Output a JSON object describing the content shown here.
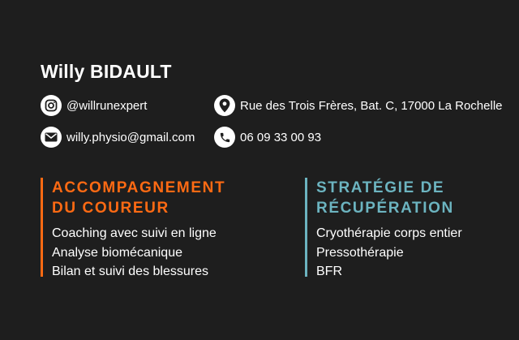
{
  "name": "Willy BIDAULT",
  "contacts": {
    "instagram": {
      "icon": "instagram-icon",
      "text": "@willrunexpert"
    },
    "email": {
      "icon": "mail-icon",
      "text": "willy.physio@gmail.com"
    },
    "address": {
      "icon": "map-pin-icon",
      "text": "Rue des Trois Frères, Bat. C, 17000 La Rochelle"
    },
    "phone": {
      "icon": "phone-icon",
      "text": "06 09 33 00 93"
    }
  },
  "sections": [
    {
      "title_line1": "ACCOMPAGNEMENT",
      "title_line2": "DU COUREUR",
      "color": "#ff6a13",
      "items": [
        "Coaching avec suivi en ligne",
        "Analyse biomécanique",
        "Bilan et suivi des blessures"
      ]
    },
    {
      "title_line1": "STRATÉGIE DE",
      "title_line2": "RÉCUPÉRATION",
      "color": "#6cb4c0",
      "items": [
        "Cryothérapie corps entier",
        "Pressothérapie",
        "BFR"
      ]
    }
  ],
  "colors": {
    "background": "#1e1e1e",
    "text": "#ffffff"
  }
}
